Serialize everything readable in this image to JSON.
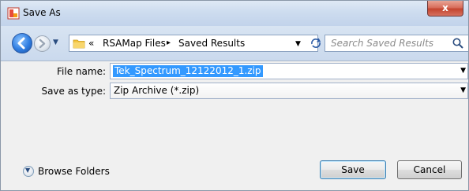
{
  "window": {
    "title": "Save As",
    "close_glyph": "x"
  },
  "nav": {
    "back_icon": "back-arrow-icon",
    "forward_icon": "forward-arrow-icon",
    "address": {
      "overflow_glyph": "«",
      "crumbs": [
        "RSAMap Files",
        "Saved Results"
      ],
      "separator": "▸"
    },
    "search": {
      "placeholder": "Search Saved Results"
    }
  },
  "form": {
    "file_name_label": "File name:",
    "file_name_value": "Tek_Spectrum_12122012_1.zip",
    "save_type_label": "Save as type:",
    "save_type_value": "Zip Archive (*.zip)"
  },
  "footer": {
    "browse_label": "Browse Folders",
    "save_label": "Save",
    "cancel_label": "Cancel"
  },
  "colors": {
    "selection": "#3399ff",
    "titlebar": "#cddcef",
    "close_button": "#c4452f"
  }
}
